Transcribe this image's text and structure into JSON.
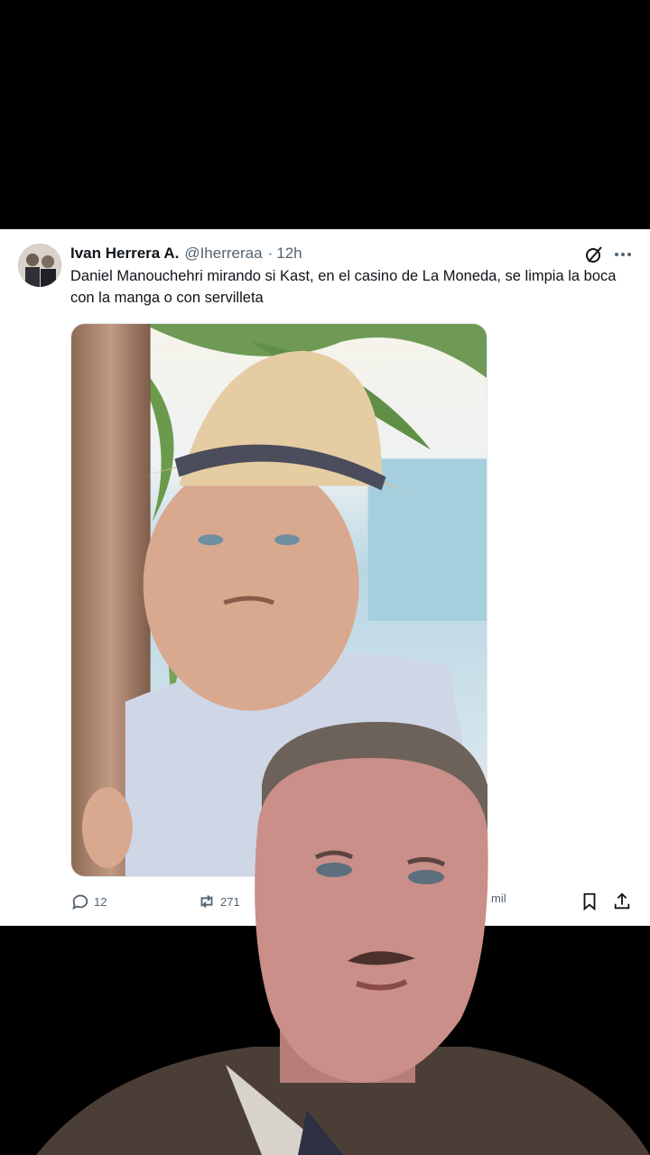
{
  "tweet": {
    "display_name": "Ivan Herrera A.",
    "handle": "@Iherreraa",
    "separator": "·",
    "time": "12h",
    "text": "Daniel Manouchehri mirando si Kast, en el casino de La Moneda, se limpia la boca con la manga o con servilleta",
    "media_alt": "photo-of-man-in-straw-hat-by-palm-tree"
  },
  "actions": {
    "replies": "12",
    "reposts": "271",
    "views_partial": "mil"
  },
  "icons": {
    "grok": "grok-icon",
    "more": "more-icon",
    "reply": "reply-icon",
    "repost": "repost-icon",
    "bookmark": "bookmark-icon",
    "share": "share-icon"
  },
  "colors": {
    "background": "#000000",
    "card": "#ffffff",
    "text_primary": "#0f1419",
    "text_secondary": "#536471"
  }
}
